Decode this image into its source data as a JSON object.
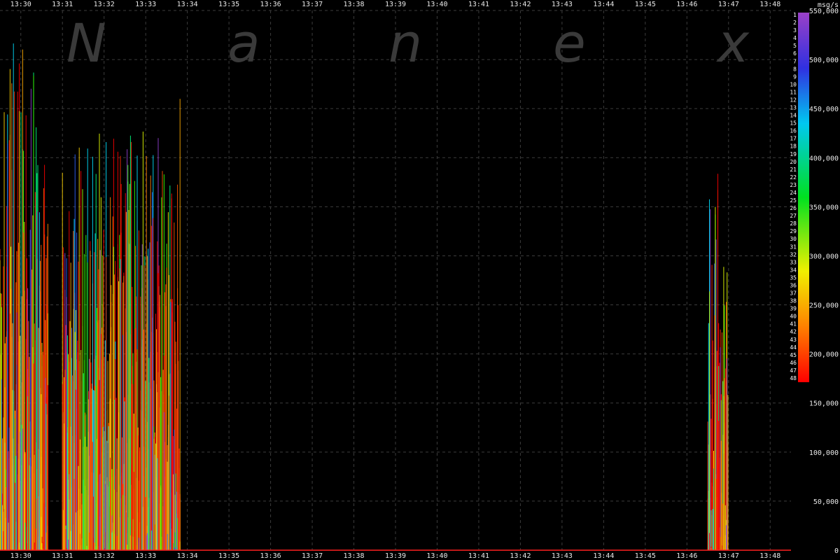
{
  "watermark": [
    "N",
    "a",
    "n",
    "e",
    "x"
  ],
  "chart_data": {
    "type": "bar",
    "ylabel": "msg/s",
    "y_ticks": [
      "0",
      "50,000",
      "100,000",
      "150,000",
      "200,000",
      "250,000",
      "300,000",
      "350,000",
      "400,000",
      "450,000",
      "500,000",
      "550,000"
    ],
    "ylim": [
      0,
      550000
    ],
    "x_ticks": [
      "13:30",
      "13:31",
      "13:32",
      "13:33",
      "13:34",
      "13:35",
      "13:36",
      "13:37",
      "13:38",
      "13:39",
      "13:40",
      "13:41",
      "13:42",
      "13:43",
      "13:44",
      "13:45",
      "13:46",
      "13:47",
      "13:48"
    ],
    "x_start": "13:29:30",
    "x_end": "13:48:30",
    "grid": true,
    "legend_labels": [
      "1",
      "2",
      "3",
      "4",
      "5",
      "6",
      "7",
      "8",
      "9",
      "10",
      "11",
      "12",
      "13",
      "14",
      "15",
      "16",
      "17",
      "18",
      "19",
      "20",
      "21",
      "22",
      "23",
      "24",
      "25",
      "26",
      "27",
      "28",
      "29",
      "30",
      "31",
      "32",
      "33",
      "34",
      "35",
      "36",
      "37",
      "38",
      "39",
      "40",
      "41",
      "42",
      "43",
      "44",
      "45",
      "46",
      "47",
      "48"
    ],
    "legend_placement": "right",
    "colors": {
      "background": "#000000",
      "grid": "#3c3c3c",
      "baseline": "#ff2020",
      "axis_text": "#e8e8e8"
    },
    "bursts": [
      {
        "start": "13:29:30",
        "end": "13:30:40",
        "peak_msg_s": 550000
      },
      {
        "start": "13:31:00",
        "end": "13:33:50",
        "peak_msg_s": 460000
      },
      {
        "start": "13:46:30",
        "end": "13:47:00",
        "peak_msg_s": 410000
      }
    ]
  }
}
